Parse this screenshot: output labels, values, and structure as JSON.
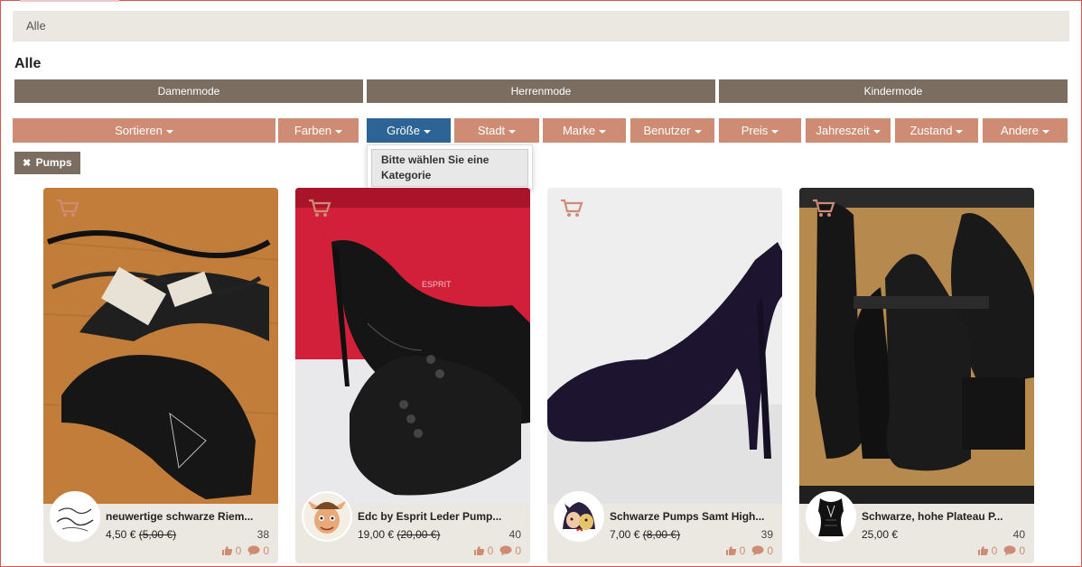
{
  "breadcrumb": "Alle",
  "page_title": "Alle",
  "gender_tabs": [
    "Damenmode",
    "Herrenmode",
    "Kindermode"
  ],
  "filters": [
    {
      "label": "Sortieren",
      "active": false
    },
    {
      "label": "Farben",
      "active": false
    },
    {
      "label": "Größe",
      "active": true
    },
    {
      "label": "Stadt",
      "active": false
    },
    {
      "label": "Marke",
      "active": false
    },
    {
      "label": "Benutzer",
      "active": false
    },
    {
      "label": "Preis",
      "active": false
    },
    {
      "label": "Jahreszeit",
      "active": false
    },
    {
      "label": "Zustand",
      "active": false
    },
    {
      "label": "Andere",
      "active": false
    }
  ],
  "size_dropdown": {
    "message": "Bitte wählen Sie eine Kategorie"
  },
  "active_tag": {
    "remove_glyph": "✖",
    "label": "Pumps"
  },
  "products": [
    {
      "title": "neuwertige schwarze Riem...",
      "price": "4,50 €",
      "old_price": "(5,00 €)",
      "size": "38",
      "likes": "0",
      "comments": "0"
    },
    {
      "title": "Edc by Esprit Leder Pump...",
      "price": "19,00 €",
      "old_price": "(20,00 €)",
      "size": "40",
      "likes": "0",
      "comments": "0"
    },
    {
      "title": "Schwarze Pumps Samt High...",
      "price": "7,00 €",
      "old_price": "(8,00 €)",
      "size": "39",
      "likes": "0",
      "comments": "0"
    },
    {
      "title": "Schwarze, hohe Plateau P...",
      "price": "25,00 €",
      "old_price": "",
      "size": "40",
      "likes": "0",
      "comments": "0"
    }
  ],
  "colors": {
    "filter_bg": "#cf8c74",
    "filter_active_bg": "#2c6496",
    "gender_bg": "#7b6d60",
    "breadcrumb_bg": "#ebe8e1",
    "accent": "#cf8c74"
  },
  "icons": {
    "cart": "cart-icon",
    "like": "thumbs-up-icon",
    "comment": "comment-icon",
    "remove": "close-icon",
    "caret": "caret-down-icon"
  }
}
